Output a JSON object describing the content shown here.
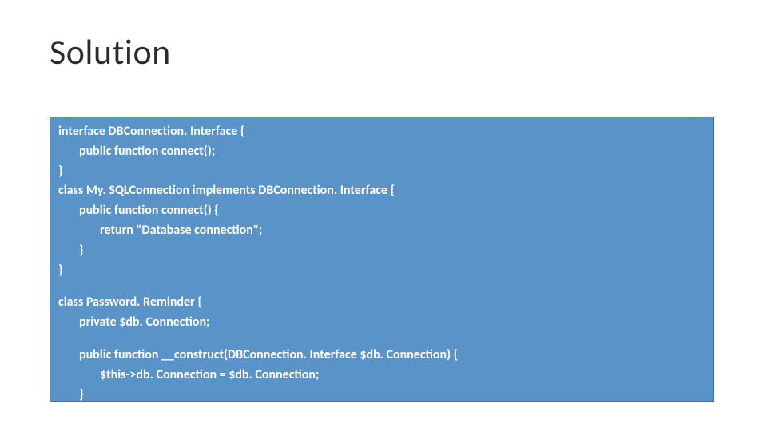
{
  "title": "Solution",
  "code": {
    "l1": "interface DBConnection. Interface {",
    "l2": "public function connect();",
    "l3": "}",
    "l4": "class My. SQLConnection implements DBConnection. Interface {",
    "l5": "public function connect() {",
    "l6": "return \"Database connection\";",
    "l7": "}",
    "l8": "}",
    "l9": "class Password. Reminder {",
    "l10": "private $db. Connection;",
    "l11": "public function __construct(DBConnection. Interface $db. Connection) {",
    "l12": "$this->db. Connection = $db. Connection;",
    "l13": "}",
    "l14": "}"
  }
}
